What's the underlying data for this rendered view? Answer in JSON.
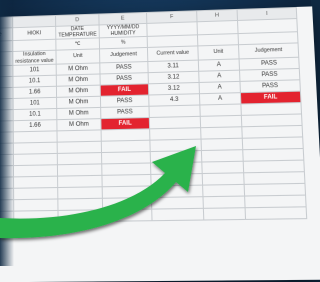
{
  "sheet": {
    "column_letters": [
      "",
      "D",
      "E",
      "F",
      "G",
      "H",
      "I"
    ],
    "top_header": {
      "c1": "me",
      "c2": "HIOKI",
      "c3_line1": "DATE",
      "c3_line2": "TEMPERATURE",
      "c4_line1": "YYYY/MM/DD",
      "c4_line2": "HUMIDITY",
      "c5": "",
      "c6": "",
      "c7": ""
    },
    "unit_header": {
      "temp_unit": "℃",
      "humidity_unit": "%"
    },
    "table_header": {
      "insulation": "Insulation resistance value",
      "unit": "Unit",
      "judgement": "Judgement",
      "current_value": "Current value",
      "unit2": "Unit",
      "judgement2": "Judgement"
    },
    "rows": [
      {
        "value": "101",
        "unit": "M Ohm",
        "judge": "PASS",
        "judge_fail": false,
        "current": "3.11",
        "unit2": "A",
        "judge2": "PASS",
        "judge2_fail": false
      },
      {
        "value": "10.1",
        "unit": "M Ohm",
        "judge": "PASS",
        "judge_fail": false,
        "current": "3.12",
        "unit2": "A",
        "judge2": "PASS",
        "judge2_fail": false
      },
      {
        "value": "1.66",
        "unit": "M Ohm",
        "judge": "FAIL",
        "judge_fail": true,
        "current": "3.12",
        "unit2": "A",
        "judge2": "PASS",
        "judge2_fail": false
      },
      {
        "value": "101",
        "unit": "M Ohm",
        "judge": "PASS",
        "judge_fail": false,
        "current": "4.3",
        "unit2": "A",
        "judge2": "FAIL",
        "judge2_fail": true
      },
      {
        "value": "10.1",
        "unit": "M Ohm",
        "judge": "PASS",
        "judge_fail": false,
        "current": "",
        "unit2": "",
        "judge2": "",
        "judge2_fail": false
      },
      {
        "value": "1.66",
        "unit": "M Ohm",
        "judge": "FAIL",
        "judge_fail": true,
        "current": "",
        "unit2": "",
        "judge2": "",
        "judge2_fail": false
      }
    ]
  },
  "colors": {
    "fail_fill": "#e3232f",
    "arrow": "#2bb24c",
    "background": "#14385c"
  },
  "icons": {
    "arrow": "curved-arrow-icon"
  }
}
